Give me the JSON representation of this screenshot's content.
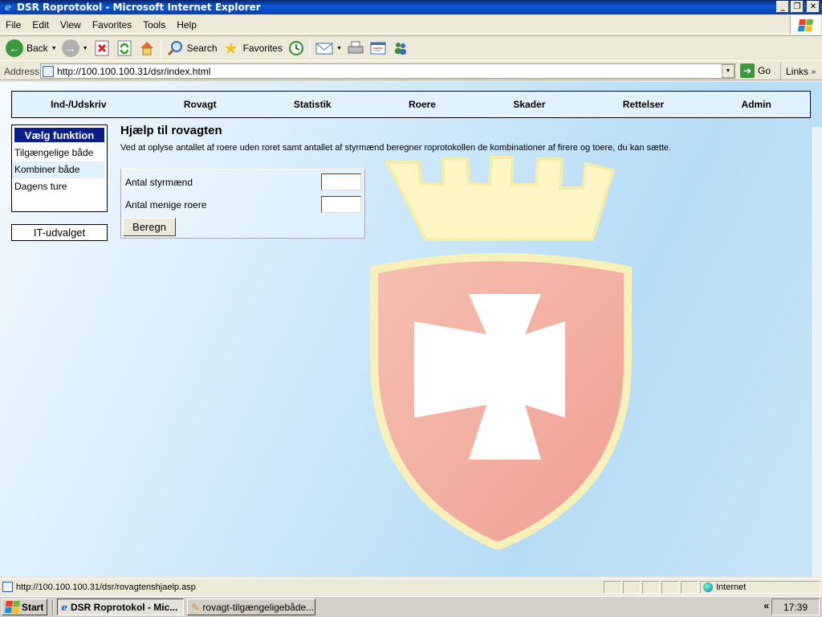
{
  "window": {
    "title": "DSR Roprotokol - Microsoft Internet Explorer"
  },
  "menu": [
    "File",
    "Edit",
    "View",
    "Favorites",
    "Tools",
    "Help"
  ],
  "toolbar": {
    "back": "Back",
    "search": "Search",
    "favorites": "Favorites"
  },
  "address": {
    "label": "Address",
    "url": "http://100.100.100.31/dsr/index.html",
    "go": "Go",
    "links": "Links"
  },
  "nav": [
    "Ind-/Udskriv",
    "Rovagt",
    "Statistik",
    "Roere",
    "Skader",
    "Rettelser",
    "Admin"
  ],
  "sidebar": {
    "header": "Vælg funktion",
    "items": [
      "Tilgængelige både",
      "Kombiner både",
      "Dagens ture"
    ],
    "selected": "Kombiner både",
    "it_box": "IT-udvalget"
  },
  "main": {
    "heading": "Hjælp til rovagten",
    "description": "Ved at oplyse antallet af roere uden roret samt antallet af styrmænd beregner roprotokollen de kombinationer af firere og toere, du kan sætte.",
    "fields": [
      {
        "label": "Antal styrmænd",
        "value": ""
      },
      {
        "label": "Antal menige roere",
        "value": ""
      }
    ],
    "button": "Beregn"
  },
  "status": {
    "url": "http://100.100.100.31/dsr/rovagtenshjaelp.asp",
    "zone": "Internet"
  },
  "taskbar": {
    "start": "Start",
    "tasks": [
      "DSR Roprotokol - Mic...",
      "rovagt-tilgængeligebåde..."
    ],
    "clock": "17:39"
  },
  "colors": {
    "titlebar": "#0a58d8",
    "sidebar_header": "#0a1e8c",
    "crest_shield": "#f2b3a6",
    "crest_crown": "#fbf6c4",
    "content_bg": "#c8e5f8"
  }
}
